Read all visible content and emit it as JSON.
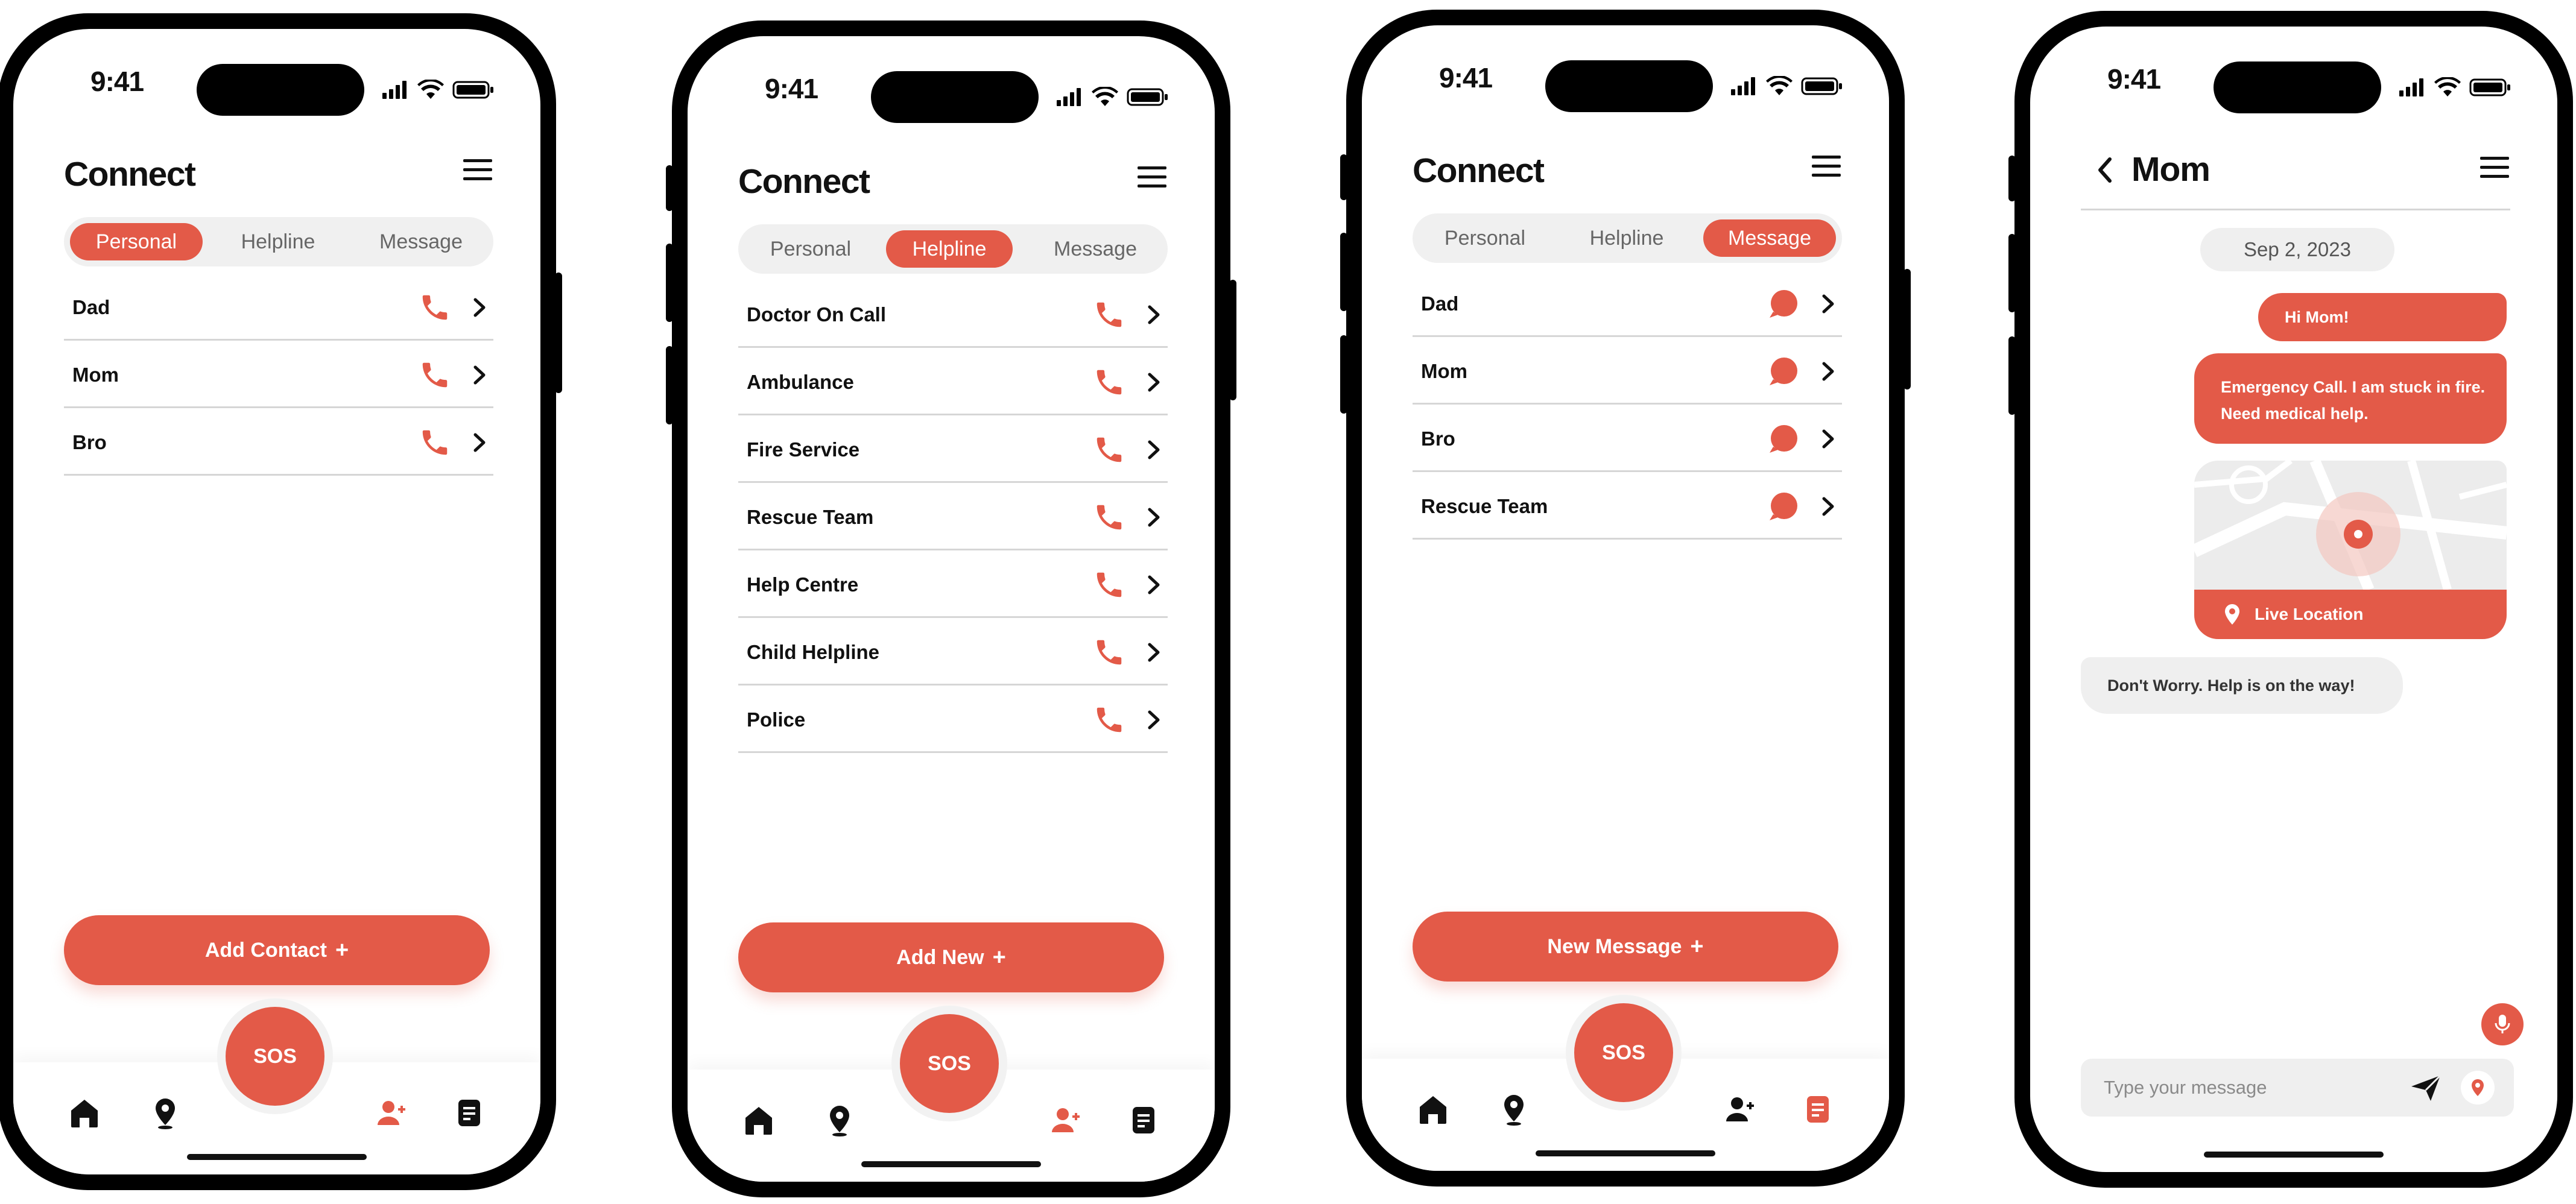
{
  "theme": {
    "accent": "#E35A48",
    "divider": "#d6d6d6",
    "segment_bg": "#efefef"
  },
  "status_bar": {
    "time": "9:41",
    "icons": [
      "signal-icon",
      "wifi-icon",
      "battery-icon"
    ]
  },
  "screens": [
    {
      "title": "Connect",
      "tabs": [
        {
          "label": "Personal",
          "active": true
        },
        {
          "label": "Helpline",
          "active": false
        },
        {
          "label": "Message",
          "active": false
        }
      ],
      "rows": [
        {
          "label": "Dad",
          "action_icon": "phone-icon"
        },
        {
          "label": "Mom",
          "action_icon": "phone-icon"
        },
        {
          "label": "Bro",
          "action_icon": "phone-icon"
        }
      ],
      "primary_button": "Add Contact",
      "sos_label": "SOS",
      "bottom_nav": {
        "icons": [
          "home-icon",
          "location-icon",
          "add-user-icon",
          "notes-icon"
        ],
        "active": "add-user-icon"
      }
    },
    {
      "title": "Connect",
      "tabs": [
        {
          "label": "Personal",
          "active": false
        },
        {
          "label": "Helpline",
          "active": true
        },
        {
          "label": "Message",
          "active": false
        }
      ],
      "rows": [
        {
          "label": "Doctor On Call",
          "action_icon": "phone-icon"
        },
        {
          "label": "Ambulance",
          "action_icon": "phone-icon"
        },
        {
          "label": "Fire Service",
          "action_icon": "phone-icon"
        },
        {
          "label": "Rescue Team",
          "action_icon": "phone-icon"
        },
        {
          "label": "Help Centre",
          "action_icon": "phone-icon"
        },
        {
          "label": "Child Helpline",
          "action_icon": "phone-icon"
        },
        {
          "label": "Police",
          "action_icon": "phone-icon"
        }
      ],
      "primary_button": "Add New",
      "sos_label": "SOS",
      "bottom_nav": {
        "icons": [
          "home-icon",
          "location-icon",
          "add-user-icon",
          "notes-icon"
        ],
        "active": "add-user-icon"
      }
    },
    {
      "title": "Connect",
      "tabs": [
        {
          "label": "Personal",
          "active": false
        },
        {
          "label": "Helpline",
          "active": false
        },
        {
          "label": "Message",
          "active": true
        }
      ],
      "rows": [
        {
          "label": "Dad",
          "action_icon": "chat-bubble-icon"
        },
        {
          "label": "Mom",
          "action_icon": "chat-bubble-icon"
        },
        {
          "label": "Bro",
          "action_icon": "chat-bubble-icon"
        },
        {
          "label": "Rescue Team",
          "action_icon": "chat-bubble-icon"
        }
      ],
      "primary_button": "New Message",
      "sos_label": "SOS",
      "bottom_nav": {
        "icons": [
          "home-icon",
          "location-icon",
          "add-user-icon",
          "notes-icon"
        ],
        "active": "notes-icon"
      }
    },
    {
      "title": "Mom",
      "date": "Sep 2, 2023",
      "messages": [
        {
          "direction": "out",
          "text": "Hi Mom!"
        },
        {
          "direction": "out",
          "text": "Emergency Call. I am stuck in fire. Need medical help."
        },
        {
          "direction": "out",
          "type": "location",
          "text": "Live Location"
        },
        {
          "direction": "in",
          "text": "Don't Worry. Help is on the way!"
        }
      ],
      "composer_placeholder": "Type your message"
    }
  ]
}
